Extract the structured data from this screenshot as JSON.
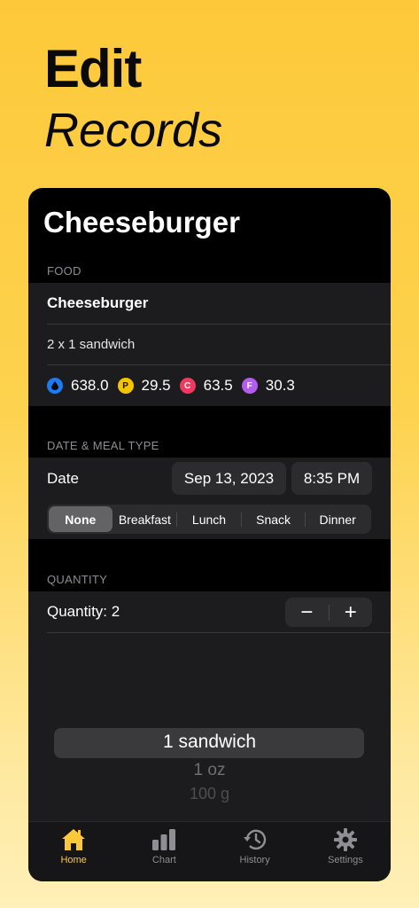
{
  "hero": {
    "line1": "Edit",
    "line2": "Records"
  },
  "screen": {
    "title": "Cheeseburger",
    "food_section": {
      "label": "FOOD",
      "name": "Cheeseburger",
      "serving": "2 x 1 sandwich",
      "macros": [
        {
          "icon": "calories-drop-icon",
          "glyph": "",
          "color": "#1e7cf2",
          "value": "638.0"
        },
        {
          "icon": "protein-icon",
          "glyph": "P",
          "color": "#f5c400",
          "value": "29.5"
        },
        {
          "icon": "carbs-icon",
          "glyph": "C",
          "color": "#ef3a5d",
          "value": "63.5"
        },
        {
          "icon": "fat-icon",
          "glyph": "F",
          "color": "#b45cf0",
          "value": "30.3"
        }
      ]
    },
    "date_section": {
      "label": "DATE & MEAL TYPE",
      "date_label": "Date",
      "date_value": "Sep 13, 2023",
      "time_value": "8:35 PM",
      "meal_types": [
        "None",
        "Breakfast",
        "Lunch",
        "Snack",
        "Dinner"
      ],
      "selected_meal": "None"
    },
    "quantity_section": {
      "label": "QUANTITY",
      "quantity_text": "Quantity: 2",
      "minus": "−",
      "plus": "+"
    },
    "picker": {
      "selected": "1 sandwich",
      "option2": "1 oz",
      "option3": "100 g"
    },
    "tabs": [
      {
        "label": "Home",
        "icon": "home-icon",
        "active": true
      },
      {
        "label": "Chart",
        "icon": "bar-chart-icon",
        "active": false
      },
      {
        "label": "History",
        "icon": "history-icon",
        "active": false
      },
      {
        "label": "Settings",
        "icon": "gear-icon",
        "active": false
      }
    ],
    "accent_color": "#fdc93a"
  }
}
